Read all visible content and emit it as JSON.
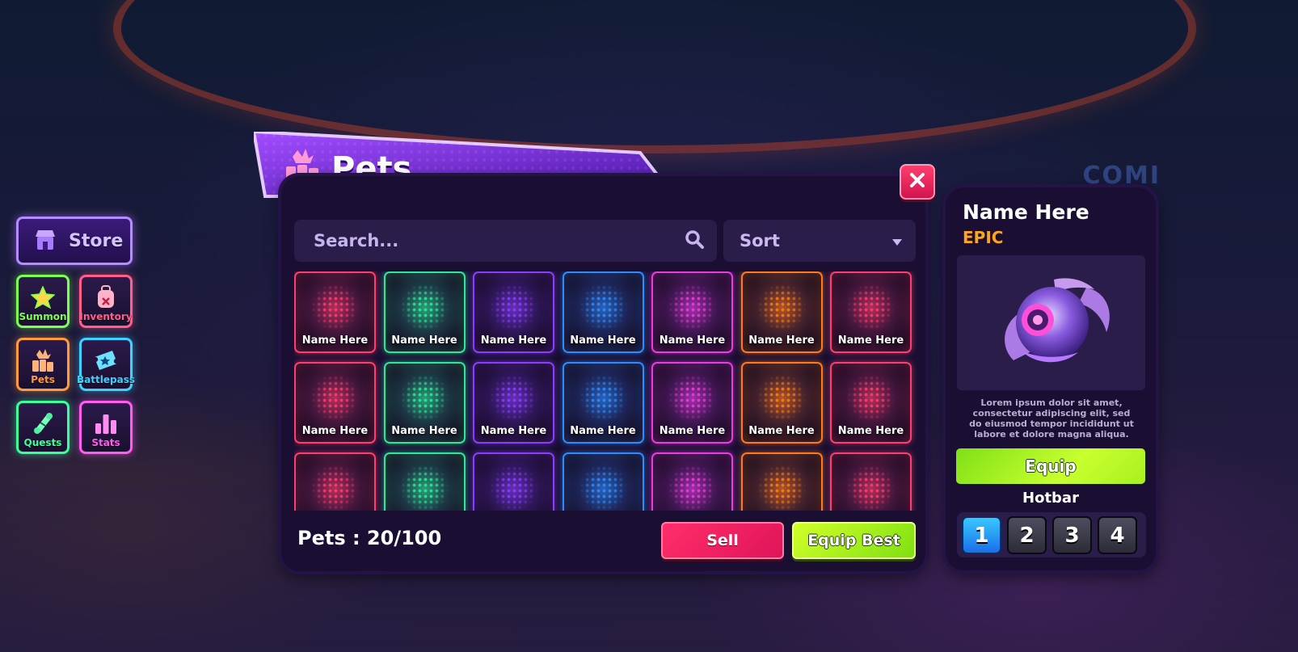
{
  "sidebar": {
    "store_label": "Store",
    "buttons": [
      {
        "label": "Summon",
        "icon": "star-icon",
        "color": "#7dff4e"
      },
      {
        "label": "Inventory",
        "icon": "backpack-icon",
        "color": "#ff5f8a"
      },
      {
        "label": "Pets",
        "icon": "pets-icon",
        "color": "#ff9a3d"
      },
      {
        "label": "Battlepass",
        "icon": "ticket-icon",
        "color": "#3fd1ff"
      },
      {
        "label": "Quests",
        "icon": "scroll-icon",
        "color": "#3dff9a"
      },
      {
        "label": "Stats",
        "icon": "bar-chart-icon",
        "color": "#ff5cf0"
      }
    ]
  },
  "window": {
    "title": "Pets",
    "search_placeholder": "Search...",
    "sort_label": "Sort",
    "slot_label": "Name Here",
    "slot_colors": [
      "#ff3d6e",
      "#2ee89a",
      "#8a3dff",
      "#2f8cff",
      "#e83de0",
      "#ff7a1a",
      "#ff3d6e"
    ],
    "count_text": "Pets : 20/100",
    "sell_label": "Sell",
    "equip_best_label": "Equip Best"
  },
  "detail": {
    "name": "Name Here",
    "rarity": "EPIC",
    "rarity_color": "#ffa41f",
    "description": "Lorem ipsum dolor sit amet, consectetur adipiscing elit, sed do eiusmod tempor incididunt ut labore et dolore magna aliqua.",
    "equip_label": "Equip",
    "hotbar_label": "Hotbar",
    "hotbar_slots": [
      "1",
      "2",
      "3",
      "4"
    ],
    "hotbar_active": "1"
  },
  "background": {
    "sign_text": "COMI"
  }
}
